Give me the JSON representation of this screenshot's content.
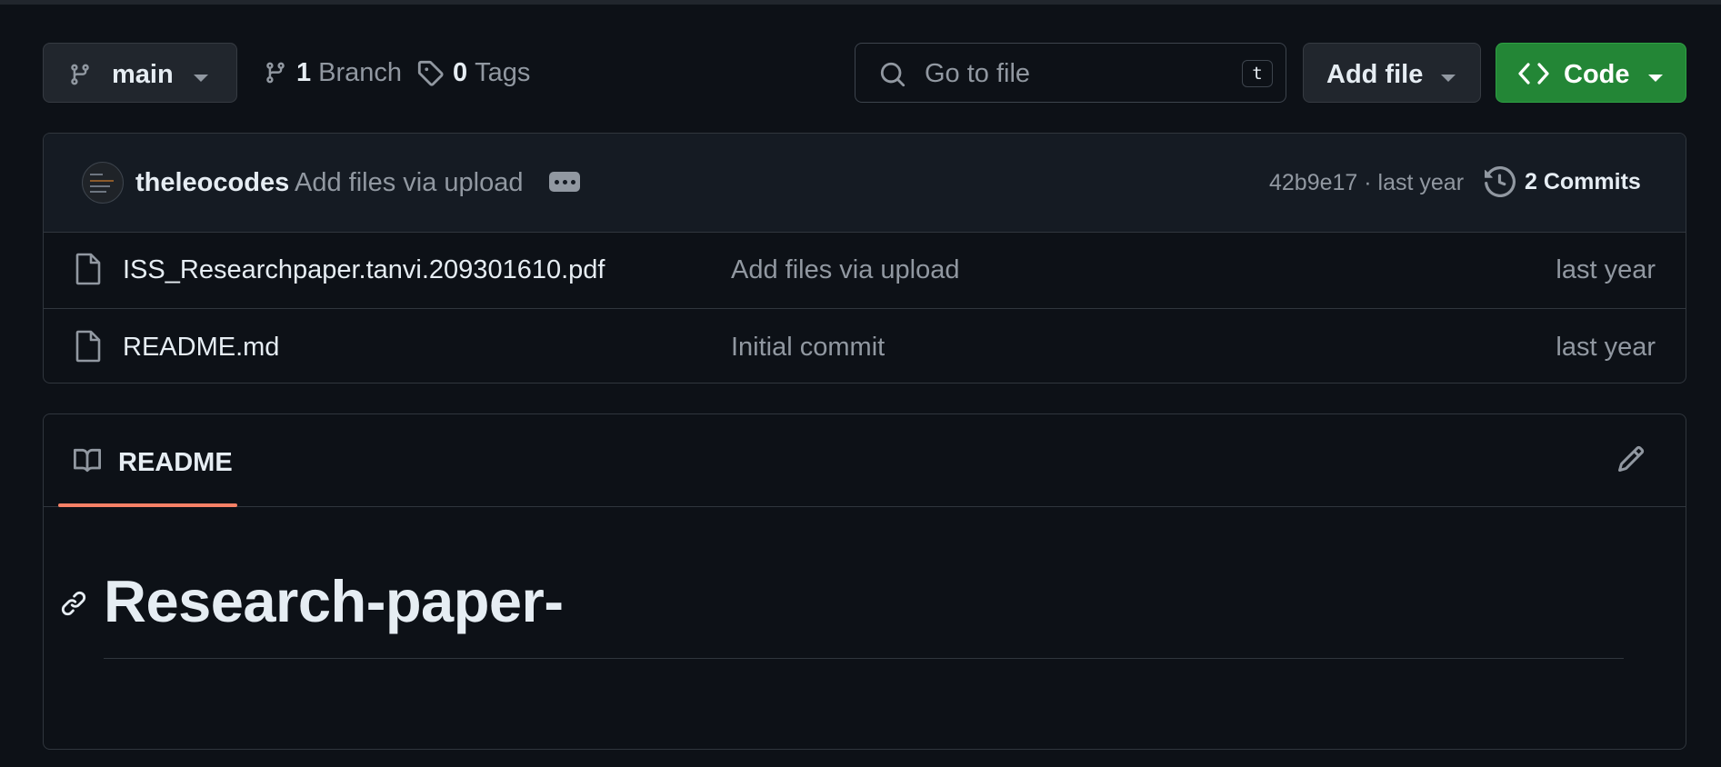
{
  "toolbar": {
    "branch_name": "main",
    "branch_count": "1",
    "branch_label": "Branch",
    "tag_count": "0",
    "tag_label": "Tags",
    "search_placeholder": "Go to file",
    "search_shortcut": "t",
    "add_file_label": "Add file",
    "code_label": "Code"
  },
  "latest_commit": {
    "author": "theleocodes",
    "message": "Add files via upload",
    "sha_time": "42b9e17 · last year",
    "commits_label": "2 Commits"
  },
  "files": [
    {
      "name": "ISS_Researchpaper.tanvi.209301610.pdf",
      "message": "Add files via upload",
      "date": "last year",
      "icon": "file-icon"
    },
    {
      "name": "README.md",
      "message": "Initial commit",
      "date": "last year",
      "icon": "file-icon"
    }
  ],
  "readme": {
    "tab_label": "README",
    "heading": "Research-paper-"
  },
  "colors": {
    "background": "#0d1117",
    "code_button": "#238636",
    "tab_underline": "#f78166"
  }
}
